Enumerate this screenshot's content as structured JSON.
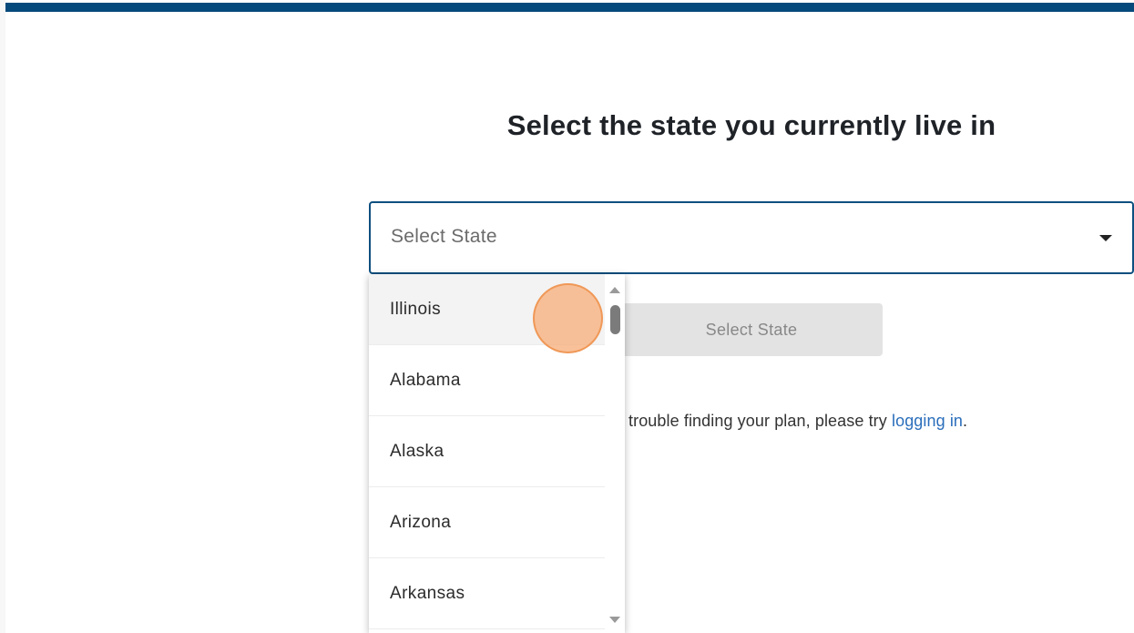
{
  "page": {
    "title": "Select the state you currently live in"
  },
  "state_select": {
    "placeholder": "Select State"
  },
  "submit_button": {
    "label": "Select State"
  },
  "help": {
    "prefix": "trouble finding your plan, please try ",
    "link_text": "logging in",
    "suffix": "."
  },
  "dropdown": {
    "options": [
      {
        "label": "Illinois",
        "active": true
      },
      {
        "label": "Alabama",
        "active": false
      },
      {
        "label": "Alaska",
        "active": false
      },
      {
        "label": "Arizona",
        "active": false
      },
      {
        "label": "Arkansas",
        "active": false
      }
    ]
  },
  "colors": {
    "accent": "#064a7c",
    "link": "#2a6ebb",
    "button_disabled_bg": "#e3e3e3",
    "click_marker": "#f7b280"
  }
}
